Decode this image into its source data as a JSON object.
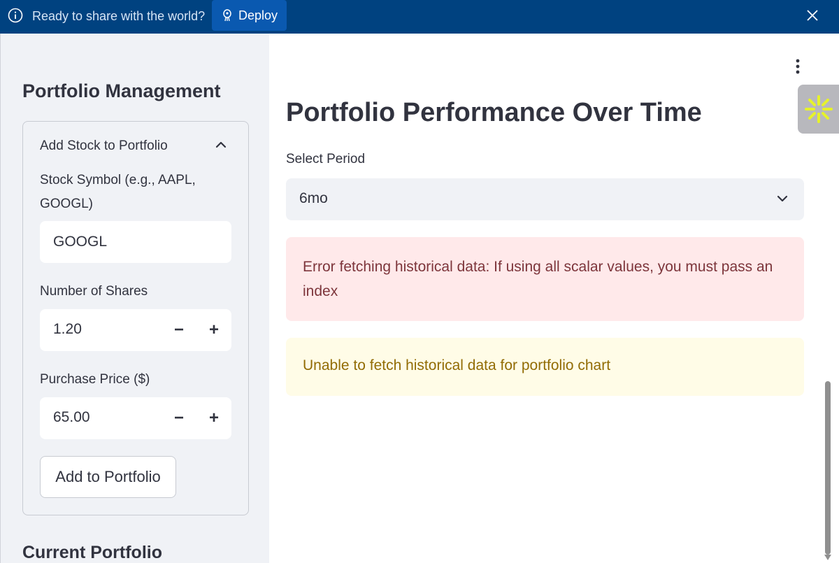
{
  "banner": {
    "message": "Ready to share with the world?",
    "deploy_label": "Deploy",
    "background_color": "#004280"
  },
  "sidebar": {
    "title": "Portfolio Management",
    "expander": {
      "header": "Add Stock to Portfolio",
      "symbol_label": "Stock Symbol (e.g., AAPL, GOOGL)",
      "symbol_value": "GOOGL",
      "shares_label": "Number of Shares",
      "shares_value": "1.20",
      "price_label": "Purchase Price ($)",
      "price_value": "65.00",
      "stepper_minus": "−",
      "stepper_plus": "+",
      "add_button_label": "Add to Portfolio"
    },
    "current_portfolio_heading": "Current Portfolio"
  },
  "main": {
    "title": "Portfolio Performance Over Time",
    "select_label": "Select Period",
    "select_value": "6mo",
    "error_message": "Error fetching historical data: If using all scalar values, you must pass an index",
    "warning_message": "Unable to fetch historical data for portfolio chart"
  },
  "icons": {
    "info": "info-circle-icon",
    "deploy": "rocket-icon",
    "close": "close-icon",
    "chevron_up": "chevron-up-icon",
    "chevron_down": "chevron-down-icon",
    "menu": "kebab-menu-icon",
    "widget": "asterisk-icon"
  },
  "colors": {
    "sidebar_bg": "#f0f2f6",
    "error_bg": "#ffe9ea",
    "error_text": "#7d353b",
    "warning_bg": "#fffce7",
    "warning_text": "#926c05",
    "widget_accent": "#e6f22a"
  }
}
